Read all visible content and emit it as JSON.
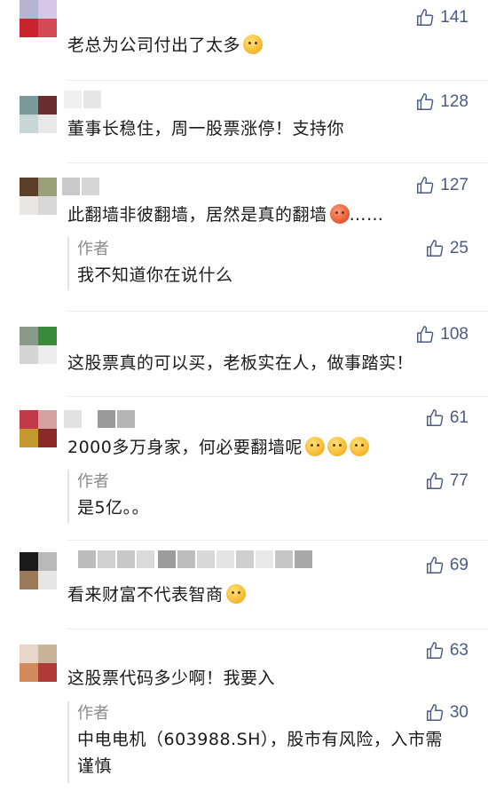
{
  "comments": [
    {
      "likes": "141",
      "text": "老总为公司付出了太多"
    },
    {
      "likes": "128",
      "text": "董事长稳住，周一股票涨停！支持你"
    },
    {
      "likes": "127",
      "text": "此翻墙非彼翻墙，居然是真的翻墙",
      "suffix": "……",
      "reply": {
        "author": "作者",
        "likes": "25",
        "text": "我不知道你在说什么"
      }
    },
    {
      "likes": "108",
      "text": "这股票真的可以买，老板实在人，做事踏实！"
    },
    {
      "likes": "61",
      "text": "2000多万身家，何必要翻墙呢",
      "reply": {
        "author": "作者",
        "likes": "77",
        "text": "是5亿。。"
      }
    },
    {
      "likes": "69",
      "text": "看来财富不代表智商"
    },
    {
      "likes": "63",
      "text": "这股票代码多少啊！我要入",
      "reply": {
        "author": "作者",
        "likes": "30",
        "text": "中电电机（603988.SH），股市有风险，入市需谨慎"
      }
    }
  ],
  "icons": {
    "like": "thumbs-up-icon",
    "emoji": "laughing-crying-emoji"
  },
  "colors": {
    "accent": "#4a5a82",
    "muted": "#8a8a8a"
  }
}
